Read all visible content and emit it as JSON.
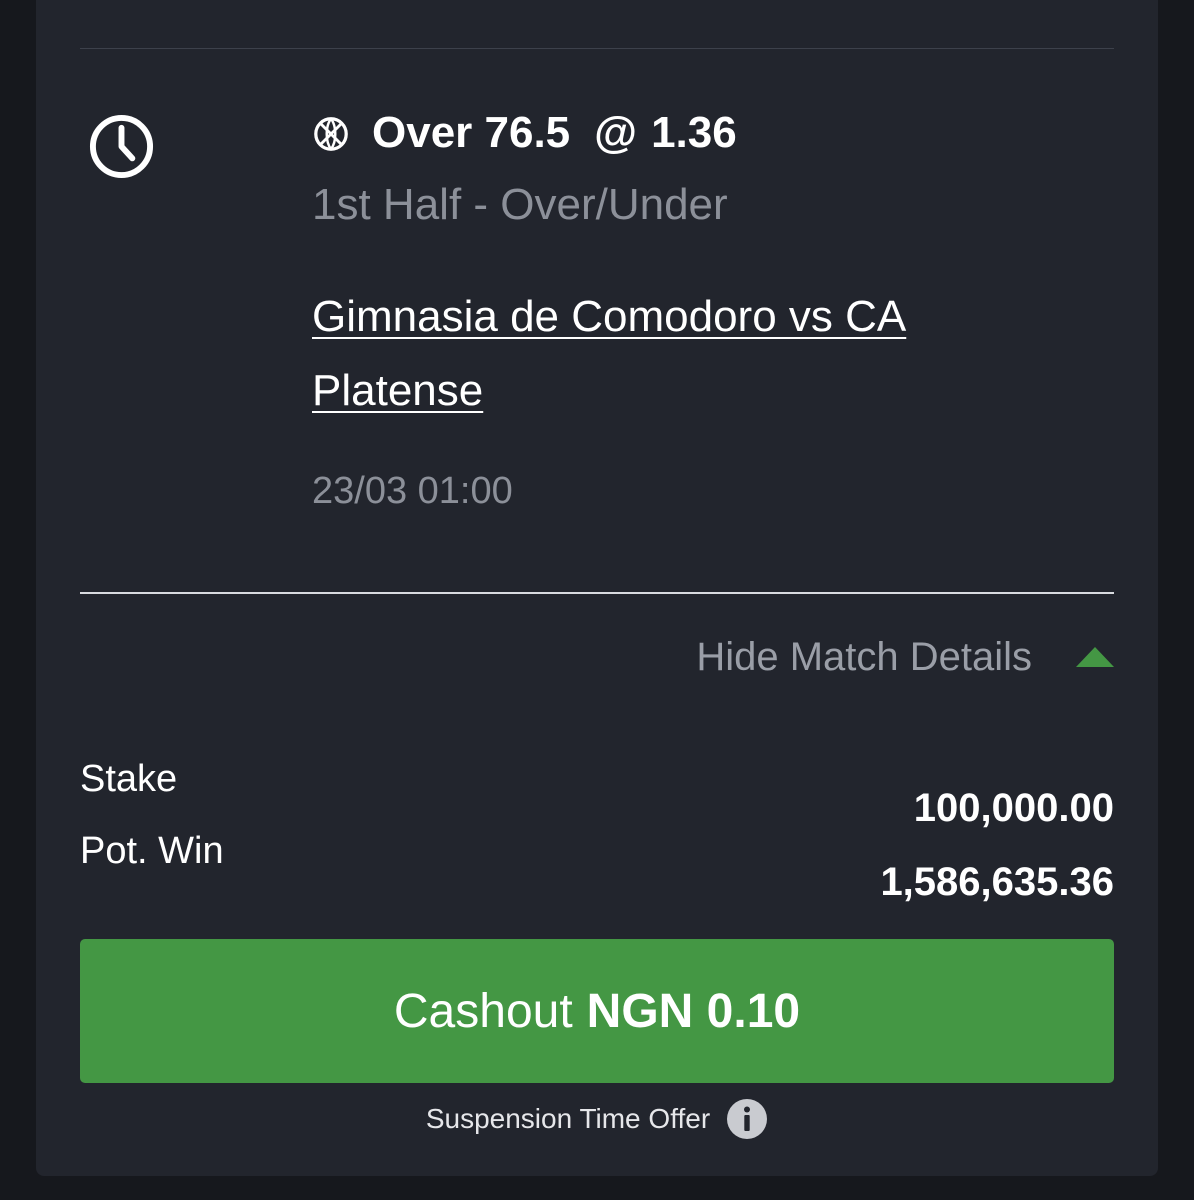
{
  "bet": {
    "selection": "Over 76.5",
    "at_symbol": "@",
    "odds": "1.36",
    "sport_icon": "basketball-icon",
    "status_icon": "clock-icon",
    "market": "1st Half - Over/Under",
    "match": "Gimnasia de Comodoro vs CA Platense",
    "datetime": "23/03 01:00"
  },
  "details_toggle": {
    "label": "Hide Match Details",
    "icon": "caret-up-icon",
    "color": "#449744"
  },
  "summary": {
    "stake_label": "Stake",
    "potwin_label": "Pot. Win",
    "stake_value": "100,000.00",
    "potwin_value": "1,586,635.36"
  },
  "cashout": {
    "prefix": "Cashout",
    "amount": "NGN 0.10",
    "color": "#449744"
  },
  "footer": {
    "suspension_text": "Suspension Time Offer",
    "icon": "info-icon"
  }
}
